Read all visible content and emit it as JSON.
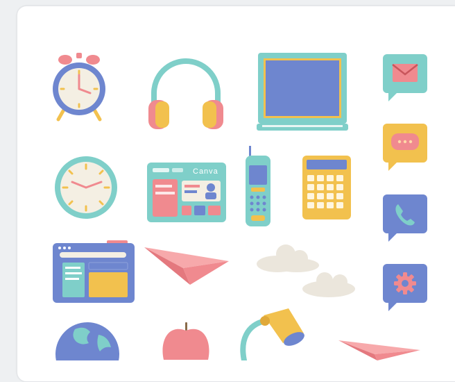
{
  "panel": {
    "canva_label": "Canva"
  },
  "colors": {
    "background": "#eef0f2",
    "card": "#ffffff",
    "teal": "#7fcfc9",
    "blue": "#6e86cf",
    "yellow": "#f2c14e",
    "pink": "#f08a8f",
    "cream": "#f4efe3"
  },
  "elements": [
    "alarm-clock",
    "headphones",
    "laptop",
    "mail-bubble",
    "wall-clock",
    "canva-dashboard",
    "mobile-phone",
    "calculator",
    "chat-bubble",
    "browser-window",
    "paper-plane",
    "clouds",
    "phone-bubble",
    "settings-bubble",
    "globe",
    "apple",
    "desk-lamp",
    "paper-plane-small"
  ]
}
